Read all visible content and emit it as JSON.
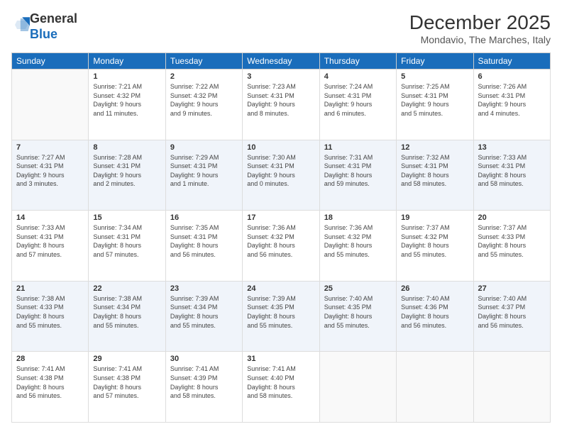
{
  "logo": {
    "general": "General",
    "blue": "Blue"
  },
  "header": {
    "month": "December 2025",
    "location": "Mondavio, The Marches, Italy"
  },
  "weekdays": [
    "Sunday",
    "Monday",
    "Tuesday",
    "Wednesday",
    "Thursday",
    "Friday",
    "Saturday"
  ],
  "weeks": [
    [
      {
        "day": "",
        "info": ""
      },
      {
        "day": "1",
        "info": "Sunrise: 7:21 AM\nSunset: 4:32 PM\nDaylight: 9 hours\nand 11 minutes."
      },
      {
        "day": "2",
        "info": "Sunrise: 7:22 AM\nSunset: 4:32 PM\nDaylight: 9 hours\nand 9 minutes."
      },
      {
        "day": "3",
        "info": "Sunrise: 7:23 AM\nSunset: 4:31 PM\nDaylight: 9 hours\nand 8 minutes."
      },
      {
        "day": "4",
        "info": "Sunrise: 7:24 AM\nSunset: 4:31 PM\nDaylight: 9 hours\nand 6 minutes."
      },
      {
        "day": "5",
        "info": "Sunrise: 7:25 AM\nSunset: 4:31 PM\nDaylight: 9 hours\nand 5 minutes."
      },
      {
        "day": "6",
        "info": "Sunrise: 7:26 AM\nSunset: 4:31 PM\nDaylight: 9 hours\nand 4 minutes."
      }
    ],
    [
      {
        "day": "7",
        "info": "Sunrise: 7:27 AM\nSunset: 4:31 PM\nDaylight: 9 hours\nand 3 minutes."
      },
      {
        "day": "8",
        "info": "Sunrise: 7:28 AM\nSunset: 4:31 PM\nDaylight: 9 hours\nand 2 minutes."
      },
      {
        "day": "9",
        "info": "Sunrise: 7:29 AM\nSunset: 4:31 PM\nDaylight: 9 hours\nand 1 minute."
      },
      {
        "day": "10",
        "info": "Sunrise: 7:30 AM\nSunset: 4:31 PM\nDaylight: 9 hours\nand 0 minutes."
      },
      {
        "day": "11",
        "info": "Sunrise: 7:31 AM\nSunset: 4:31 PM\nDaylight: 8 hours\nand 59 minutes."
      },
      {
        "day": "12",
        "info": "Sunrise: 7:32 AM\nSunset: 4:31 PM\nDaylight: 8 hours\nand 58 minutes."
      },
      {
        "day": "13",
        "info": "Sunrise: 7:33 AM\nSunset: 4:31 PM\nDaylight: 8 hours\nand 58 minutes."
      }
    ],
    [
      {
        "day": "14",
        "info": "Sunrise: 7:33 AM\nSunset: 4:31 PM\nDaylight: 8 hours\nand 57 minutes."
      },
      {
        "day": "15",
        "info": "Sunrise: 7:34 AM\nSunset: 4:31 PM\nDaylight: 8 hours\nand 57 minutes."
      },
      {
        "day": "16",
        "info": "Sunrise: 7:35 AM\nSunset: 4:31 PM\nDaylight: 8 hours\nand 56 minutes."
      },
      {
        "day": "17",
        "info": "Sunrise: 7:36 AM\nSunset: 4:32 PM\nDaylight: 8 hours\nand 56 minutes."
      },
      {
        "day": "18",
        "info": "Sunrise: 7:36 AM\nSunset: 4:32 PM\nDaylight: 8 hours\nand 55 minutes."
      },
      {
        "day": "19",
        "info": "Sunrise: 7:37 AM\nSunset: 4:32 PM\nDaylight: 8 hours\nand 55 minutes."
      },
      {
        "day": "20",
        "info": "Sunrise: 7:37 AM\nSunset: 4:33 PM\nDaylight: 8 hours\nand 55 minutes."
      }
    ],
    [
      {
        "day": "21",
        "info": "Sunrise: 7:38 AM\nSunset: 4:33 PM\nDaylight: 8 hours\nand 55 minutes."
      },
      {
        "day": "22",
        "info": "Sunrise: 7:38 AM\nSunset: 4:34 PM\nDaylight: 8 hours\nand 55 minutes."
      },
      {
        "day": "23",
        "info": "Sunrise: 7:39 AM\nSunset: 4:34 PM\nDaylight: 8 hours\nand 55 minutes."
      },
      {
        "day": "24",
        "info": "Sunrise: 7:39 AM\nSunset: 4:35 PM\nDaylight: 8 hours\nand 55 minutes."
      },
      {
        "day": "25",
        "info": "Sunrise: 7:40 AM\nSunset: 4:35 PM\nDaylight: 8 hours\nand 55 minutes."
      },
      {
        "day": "26",
        "info": "Sunrise: 7:40 AM\nSunset: 4:36 PM\nDaylight: 8 hours\nand 56 minutes."
      },
      {
        "day": "27",
        "info": "Sunrise: 7:40 AM\nSunset: 4:37 PM\nDaylight: 8 hours\nand 56 minutes."
      }
    ],
    [
      {
        "day": "28",
        "info": "Sunrise: 7:41 AM\nSunset: 4:38 PM\nDaylight: 8 hours\nand 56 minutes."
      },
      {
        "day": "29",
        "info": "Sunrise: 7:41 AM\nSunset: 4:38 PM\nDaylight: 8 hours\nand 57 minutes."
      },
      {
        "day": "30",
        "info": "Sunrise: 7:41 AM\nSunset: 4:39 PM\nDaylight: 8 hours\nand 58 minutes."
      },
      {
        "day": "31",
        "info": "Sunrise: 7:41 AM\nSunset: 4:40 PM\nDaylight: 8 hours\nand 58 minutes."
      },
      {
        "day": "",
        "info": ""
      },
      {
        "day": "",
        "info": ""
      },
      {
        "day": "",
        "info": ""
      }
    ]
  ]
}
